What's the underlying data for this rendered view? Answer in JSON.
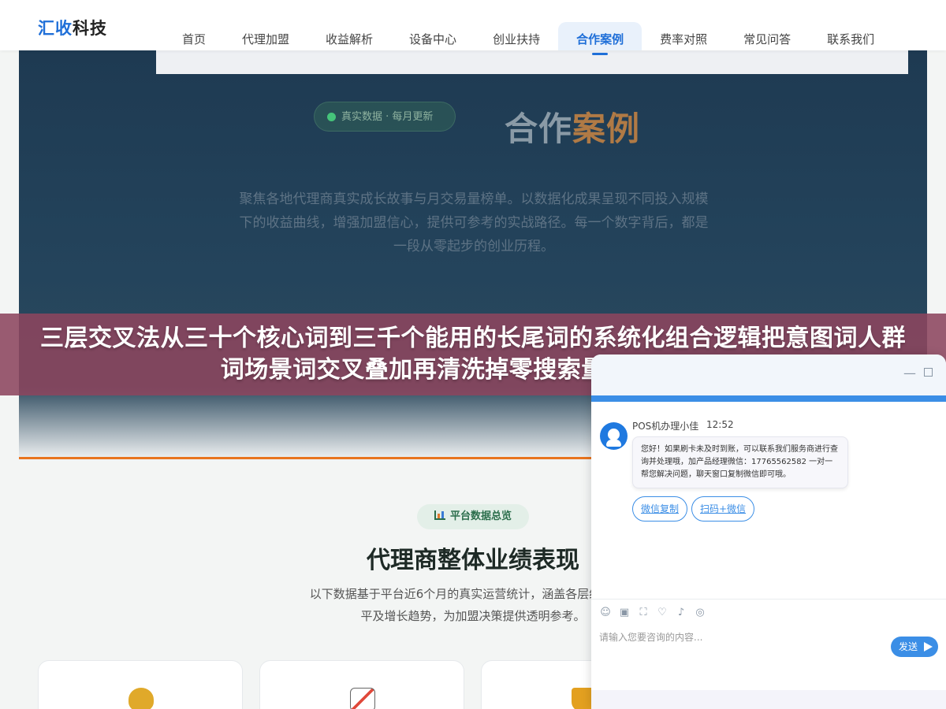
{
  "header": {
    "logo_part1": "汇收",
    "logo_part2": "科技",
    "nav": [
      "首页",
      "代理加盟",
      "收益解析",
      "设备中心",
      "创业扶持",
      "合作案例",
      "费率对照",
      "常见问答",
      "联系我们"
    ],
    "active_nav": "合作案例"
  },
  "hero": {
    "badge": "真实数据 · 每月更新",
    "title_part1": "合作",
    "title_part2": "案例",
    "desc": "聚焦各地代理商真实成长故事与月交易量榜单。以数据化成果呈现不同投入规模下的收益曲线，增强加盟信心，提供可参考的实战路径。每一个数字背后，都是一段从零起步的创业历程。"
  },
  "banner": {
    "text": "三层交叉法从三十个核心词到三千个能用的长尾词的系统化组合逻辑把意图词人群词场景词交叉叠加再清洗掉零搜索量的无效组合"
  },
  "stats": {
    "pill": "平台数据总览",
    "title": "代理商整体业绩表现",
    "desc_line1": "以下数据基于平台近6个月的真实运营统计，涵盖各层级代理商",
    "desc_line2": "平及增长趋势，为加盟决策提供透明参考。"
  },
  "chat": {
    "agent_name": "POS机办理小佳",
    "time": "12:52",
    "message": "您好！如果刷卡未及时到账，可以联系我们服务商进行查询并处理哦，加产品经理微信：17765562582 一对一帮您解决问题，聊天窗口复制微信即可哦。",
    "btn_copy": "微信复制",
    "btn_scan": "扫码+微信",
    "input_placeholder": "请输入您要咨询的内容...",
    "send": "发送",
    "min_glyph": "—"
  },
  "colors": {
    "brand_blue": "#1f6fd8",
    "accent_orange": "#e8741f",
    "banner_bg": "#8c465f",
    "chat_blue": "#3b8ee6"
  }
}
